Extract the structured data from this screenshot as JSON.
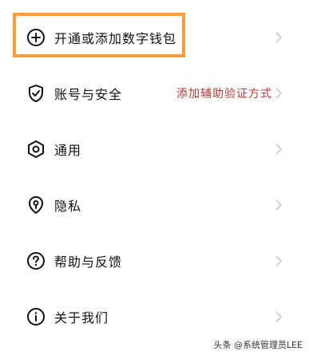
{
  "colors": {
    "highlight": "#ff9b2f",
    "hint_text": "#c0392b",
    "chevron": "#c8c8c8"
  },
  "menu": {
    "items": [
      {
        "icon": "plus-circle-icon",
        "label": "开通或添加数字钱包",
        "hint": ""
      },
      {
        "icon": "shield-check-icon",
        "label": "账号与安全",
        "hint": "添加辅助验证方式"
      },
      {
        "icon": "hexagon-gear-icon",
        "label": "通用",
        "hint": ""
      },
      {
        "icon": "privacy-lock-icon",
        "label": "隐私",
        "hint": ""
      },
      {
        "icon": "question-circle-icon",
        "label": "帮助与反馈",
        "hint": ""
      },
      {
        "icon": "info-circle-icon",
        "label": "关于我们",
        "hint": ""
      }
    ]
  },
  "watermark": {
    "text": "头条 @系统管理员LEE"
  }
}
